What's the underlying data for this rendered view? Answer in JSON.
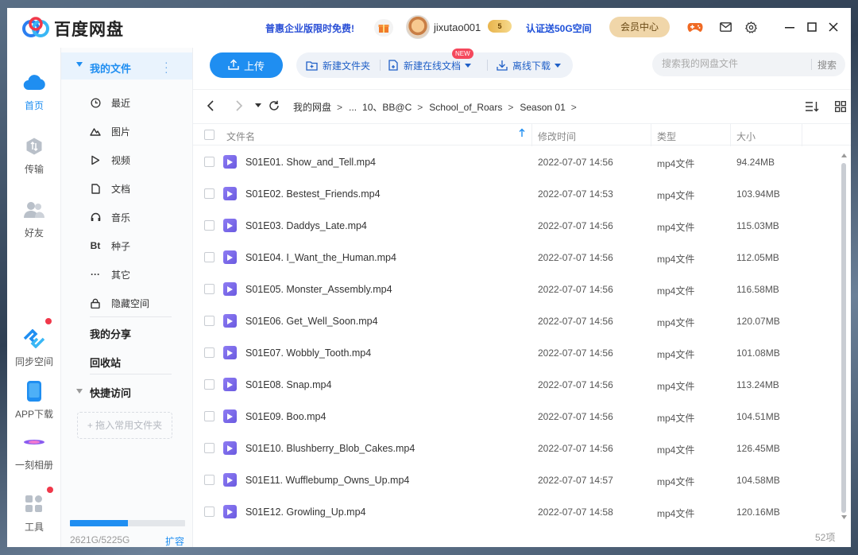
{
  "app": {
    "title": "百度网盘",
    "promo": "普惠企业版限时免费!",
    "username": "jixutao001",
    "vip_level": "5",
    "cert_promo": "认证送50G空间",
    "member_center": "会员中心"
  },
  "rail": {
    "items": [
      {
        "label": "首页",
        "icon": "cloud-icon"
      },
      {
        "label": "传输",
        "icon": "transfer-icon"
      },
      {
        "label": "好友",
        "icon": "friends-icon"
      },
      {
        "label": "同步空间",
        "icon": "sync-icon"
      },
      {
        "label": "APP下载",
        "icon": "phone-icon"
      },
      {
        "label": "一刻相册",
        "icon": "album-icon"
      },
      {
        "label": "工具",
        "icon": "tools-icon"
      }
    ]
  },
  "sidebar": {
    "my_files": "我的文件",
    "items": [
      {
        "label": "最近",
        "icon": "clock-icon"
      },
      {
        "label": "图片",
        "icon": "image-icon"
      },
      {
        "label": "视频",
        "icon": "play-icon"
      },
      {
        "label": "文档",
        "icon": "document-icon"
      },
      {
        "label": "音乐",
        "icon": "headphones-icon"
      },
      {
        "label": "种子",
        "icon": "bt-icon",
        "glyph": "Bt"
      },
      {
        "label": "其它",
        "icon": "more-icon",
        "glyph": "···"
      },
      {
        "label": "隐藏空间",
        "icon": "lock-icon"
      }
    ],
    "my_share": "我的分享",
    "recycle": "回收站",
    "quick_access": "快捷访问",
    "drop_hint": "+ 拖入常用文件夹",
    "quota_text": "2621G/5225G",
    "quota_used_fraction": 0.5016,
    "expand": "扩容"
  },
  "toolbar": {
    "upload": "上传",
    "new_folder": "新建文件夹",
    "new_online_doc": "新建在线文档",
    "new_badge": "NEW",
    "offline_download": "离线下载",
    "search_placeholder": "搜索我的网盘文件",
    "search_button": "搜索"
  },
  "breadcrumb": {
    "items": [
      "我的网盘",
      "...",
      "10、BB@C",
      "School_of_Roars",
      "Season 01"
    ],
    "separator": ">"
  },
  "table": {
    "headers": {
      "name": "文件名",
      "modified": "修改时间",
      "type": "类型",
      "size": "大小"
    },
    "rows": [
      {
        "name": "S01E01. Show_and_Tell.mp4",
        "modified": "2022-07-07 14:56",
        "type": "mp4文件",
        "size": "94.24MB"
      },
      {
        "name": "S01E02. Bestest_Friends.mp4",
        "modified": "2022-07-07 14:53",
        "type": "mp4文件",
        "size": "103.94MB"
      },
      {
        "name": "S01E03. Daddys_Late.mp4",
        "modified": "2022-07-07 14:56",
        "type": "mp4文件",
        "size": "115.03MB"
      },
      {
        "name": "S01E04. I_Want_the_Human.mp4",
        "modified": "2022-07-07 14:56",
        "type": "mp4文件",
        "size": "112.05MB"
      },
      {
        "name": "S01E05. Monster_Assembly.mp4",
        "modified": "2022-07-07 14:56",
        "type": "mp4文件",
        "size": "116.58MB"
      },
      {
        "name": "S01E06. Get_Well_Soon.mp4",
        "modified": "2022-07-07 14:56",
        "type": "mp4文件",
        "size": "120.07MB"
      },
      {
        "name": "S01E07. Wobbly_Tooth.mp4",
        "modified": "2022-07-07 14:56",
        "type": "mp4文件",
        "size": "101.08MB"
      },
      {
        "name": "S01E08. Snap.mp4",
        "modified": "2022-07-07 14:56",
        "type": "mp4文件",
        "size": "113.24MB"
      },
      {
        "name": "S01E09. Boo.mp4",
        "modified": "2022-07-07 14:56",
        "type": "mp4文件",
        "size": "104.51MB"
      },
      {
        "name": "S01E10. Blushberry_Blob_Cakes.mp4",
        "modified": "2022-07-07 14:56",
        "type": "mp4文件",
        "size": "126.45MB"
      },
      {
        "name": "S01E11. Wufflebump_Owns_Up.mp4",
        "modified": "2022-07-07 14:57",
        "type": "mp4文件",
        "size": "104.58MB"
      },
      {
        "name": "S01E12. Growling_Up.mp4",
        "modified": "2022-07-07 14:58",
        "type": "mp4文件",
        "size": "120.16MB"
      }
    ],
    "count": "52项"
  },
  "colors": {
    "accent": "#1f8ef1",
    "promo_text": "#2a4fd6",
    "badge_red": "#f5485c",
    "video_icon": "#7b6bea"
  }
}
